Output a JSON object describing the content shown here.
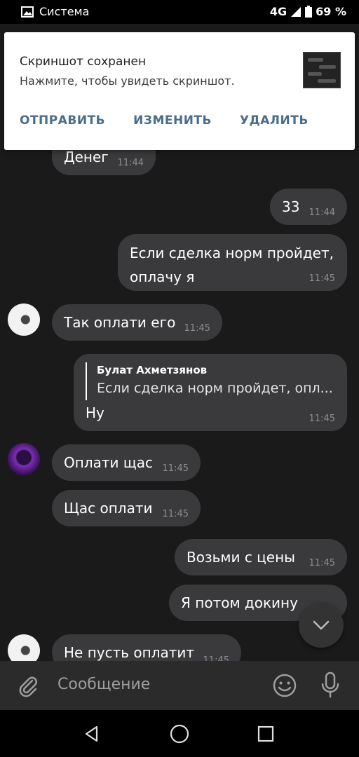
{
  "status_bar": {
    "app": "Система",
    "network": "4G",
    "battery": "69 %"
  },
  "notification": {
    "title": "Скриншот сохранен",
    "subtitle": "Нажмите, чтобы увидеть скриншот.",
    "actions": [
      "ОТПРАВИТЬ",
      "ИЗМЕНИТЬ",
      "УДАЛИТЬ"
    ]
  },
  "messages": [
    {
      "side": "in",
      "text": "Денег",
      "time": "11:44"
    },
    {
      "side": "out",
      "text": "33",
      "time": "11:44"
    },
    {
      "side": "out",
      "text": "Если сделка норм пройдет, оплачу я",
      "time": "11:45"
    },
    {
      "side": "in",
      "text": "Так оплати его",
      "time": "11:45"
    },
    {
      "side": "out",
      "reply_author": "Булат Ахметзянов",
      "reply_text": "Если сделка норм пройдет, опл...",
      "text": "Ну",
      "time": "11:45"
    },
    {
      "side": "in",
      "text": "Оплати щас",
      "time": "11:45"
    },
    {
      "side": "in",
      "text": "Щас оплати",
      "time": "11:45"
    },
    {
      "side": "out",
      "text": "Возьми с цены",
      "time": "11:45"
    },
    {
      "side": "out",
      "text": "Я потом докину",
      "time": ""
    },
    {
      "side": "in",
      "text": "Не пусть оплатит",
      "time": "11:45"
    }
  ],
  "composer": {
    "placeholder": "Сообщение"
  },
  "icons": {
    "attach": "paperclip-icon",
    "emoji": "emoji-icon",
    "mic": "microphone-icon",
    "scroll": "chevron-down-icon",
    "nav": [
      "back-icon",
      "home-icon",
      "recents-icon"
    ]
  }
}
